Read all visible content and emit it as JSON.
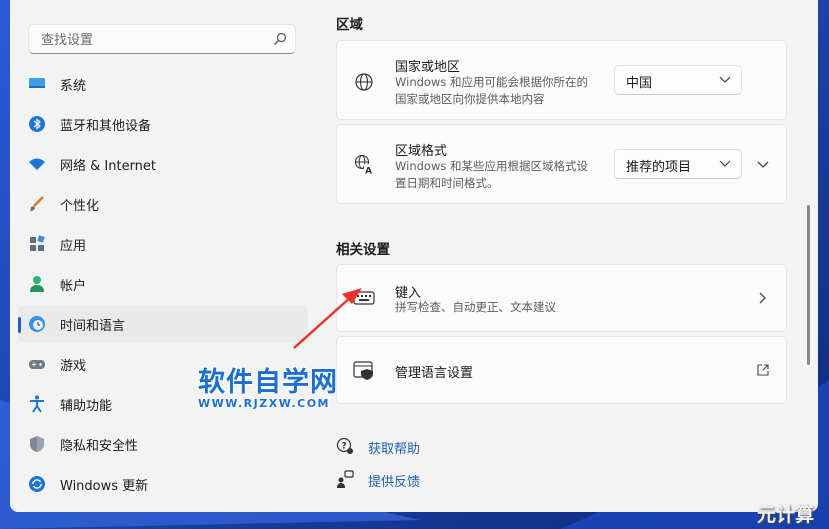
{
  "search": {
    "placeholder": "查找设置",
    "icon": "search-icon"
  },
  "sidebar": {
    "items": [
      {
        "label": "系统",
        "icon": "monitor-icon"
      },
      {
        "label": "蓝牙和其他设备",
        "icon": "bluetooth-icon"
      },
      {
        "label": "网络 & Internet",
        "icon": "wifi-icon"
      },
      {
        "label": "个性化",
        "icon": "brush-icon"
      },
      {
        "label": "应用",
        "icon": "apps-icon"
      },
      {
        "label": "帐户",
        "icon": "person-icon"
      },
      {
        "label": "时间和语言",
        "icon": "clock-globe-icon",
        "selected": true
      },
      {
        "label": "游戏",
        "icon": "gamepad-icon"
      },
      {
        "label": "辅助功能",
        "icon": "accessibility-icon"
      },
      {
        "label": "隐私和安全性",
        "icon": "shield-icon"
      },
      {
        "label": "Windows 更新",
        "icon": "update-icon"
      }
    ]
  },
  "region": {
    "heading": "区域",
    "country": {
      "title": "国家或地区",
      "desc_line1": "Windows 和应用可能会根据你所在的",
      "desc_line2": "国家或地区向你提供本地内容",
      "value": "中国"
    },
    "format": {
      "title": "区域格式",
      "desc_line1": "Windows 和某些应用根据区域格式设",
      "desc_line2": "置日期和时间格式。",
      "value": "推荐的项目"
    }
  },
  "related": {
    "heading": "相关设置",
    "typing": {
      "title": "键入",
      "desc": "拼写检查、自动更正、文本建议"
    },
    "language": {
      "title": "管理语言设置"
    }
  },
  "links": {
    "help": "获取帮助",
    "feedback": "提供反馈"
  },
  "watermark": {
    "main": "软件自学网",
    "sub": "WWW.RJZXW.COM",
    "corner": "元计算"
  },
  "colors": {
    "accent": "#2061c0",
    "arrow": "#e8332a"
  }
}
